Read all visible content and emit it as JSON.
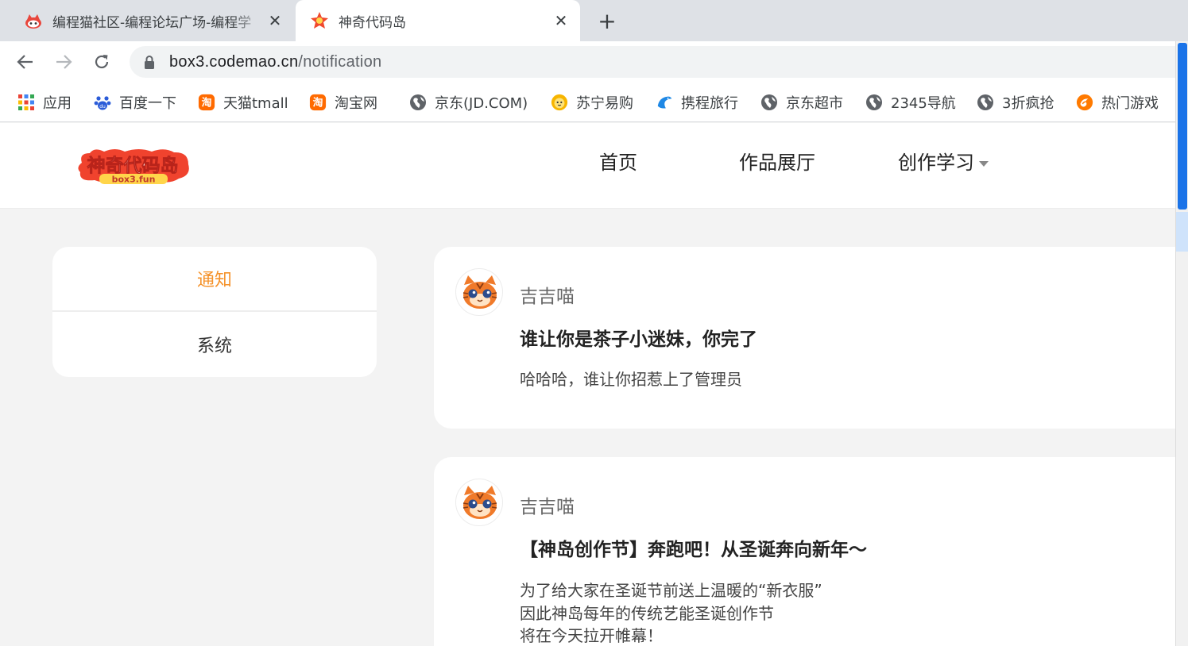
{
  "browser": {
    "tabs": [
      {
        "title": "编程猫社区-编程论坛广场-编程学",
        "state": "inactive"
      },
      {
        "title": "神奇代码岛",
        "state": "active"
      }
    ],
    "close_glyph": "✕",
    "new_tab_glyph": "+",
    "url_host": "box3.codemao.cn",
    "url_path": "/notification",
    "bookmarks": [
      {
        "label": "应用",
        "icon": "apps-grid-icon"
      },
      {
        "label": "百度一下",
        "icon": "baidu-paw-icon"
      },
      {
        "label": "天猫tmall",
        "icon": "taobao-icon"
      },
      {
        "label": "淘宝网",
        "icon": "taobao-icon"
      },
      {
        "label": "京东(JD.COM)",
        "icon": "globe-icon"
      },
      {
        "label": "苏宁易购",
        "icon": "suning-lion-icon"
      },
      {
        "label": "携程旅行",
        "icon": "ctrip-dolphin-icon"
      },
      {
        "label": "京东超市",
        "icon": "globe-icon"
      },
      {
        "label": "2345导航",
        "icon": "globe-icon"
      },
      {
        "label": "3折疯抢",
        "icon": "globe-icon"
      },
      {
        "label": "热门游戏",
        "icon": "game-flame-icon"
      }
    ]
  },
  "site": {
    "logo_text": "神奇代码岛",
    "logo_sub": "box3.fun",
    "nav": [
      "首页",
      "作品展厅",
      "创作学习"
    ]
  },
  "sidebar": {
    "items": [
      {
        "label": "通知",
        "active": true
      },
      {
        "label": "系统",
        "active": false
      }
    ]
  },
  "notifications": [
    {
      "author": "吉吉喵",
      "title": "谁让你是茶子小迷妹，你完了",
      "body": [
        "哈哈哈，谁让你招惹上了管理员"
      ]
    },
    {
      "author": "吉吉喵",
      "title": "【神岛创作节】奔跑吧！从圣诞奔向新年～",
      "body": [
        "为了给大家在圣诞节前送上温暖的“新衣服”",
        "因此神岛每年的传统艺能圣诞创作节",
        "将在今天拉开帷幕！"
      ]
    }
  ],
  "colors": {
    "accent": "#f5922a",
    "page_bg": "#f3f3f3",
    "tab_strip": "#dee1e6"
  }
}
